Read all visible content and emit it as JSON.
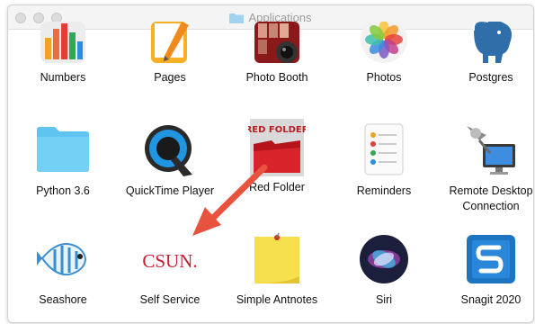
{
  "window": {
    "title": "Applications"
  },
  "apps": [
    {
      "label": "Numbers"
    },
    {
      "label": "Pages"
    },
    {
      "label": "Photo Booth"
    },
    {
      "label": "Photos"
    },
    {
      "label": "Postgres"
    },
    {
      "label": "Python 3.6"
    },
    {
      "label": "QuickTime Player"
    },
    {
      "label": "Red Folder",
      "icon_text": "RED FOLDER"
    },
    {
      "label": "Reminders"
    },
    {
      "label": "Remote Desktop\nConnection"
    },
    {
      "label": "Seashore"
    },
    {
      "label": "Self Service",
      "icon_text": "CSUN."
    },
    {
      "label": "Simple Antnotes"
    },
    {
      "label": "Siri"
    },
    {
      "label": "Snagit 2020"
    }
  ],
  "colors": {
    "arrow": "#e8533f",
    "csun_red": "#c21f32",
    "folder_blue": "#5fc4f0"
  }
}
